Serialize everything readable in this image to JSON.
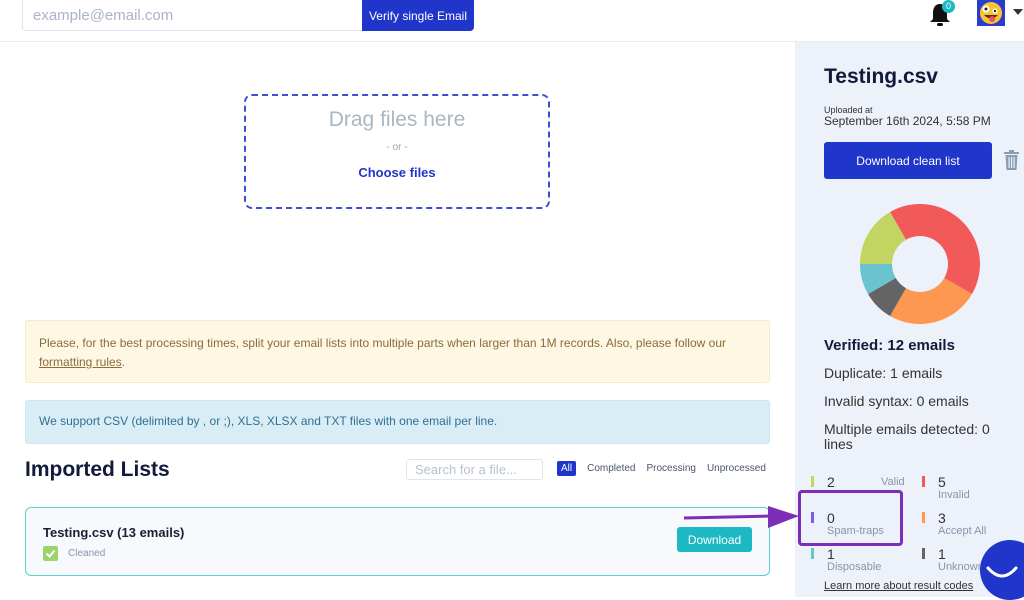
{
  "topbar": {
    "email_placeholder": "example@email.com",
    "verify_button": "Verify single Email",
    "notification_count": "0"
  },
  "upload": {
    "title": "Drag files here",
    "or": "- or -",
    "choose": "Choose files"
  },
  "notices": {
    "warning_text": "Please, for the best processing times, split your email lists into multiple parts when larger than 1M records. Also, please follow our ",
    "warning_link": "formatting rules",
    "warning_end": ".",
    "info_text": "We support CSV (delimited by , or ;), XLS, XLSX and TXT files with one email per line."
  },
  "imported": {
    "title": "Imported Lists",
    "search_placeholder": "Search for a file...",
    "filters": [
      "All",
      "Completed",
      "Processing",
      "Unprocessed"
    ],
    "active_filter": "All",
    "lists": [
      {
        "name": "Testing.csv (13 emails)",
        "status": "Cleaned",
        "action": "Download"
      }
    ]
  },
  "sidebar": {
    "file_title": "Testing.csv",
    "uploaded_label": "Uploaded at",
    "uploaded_date": "September 16th 2024, 5:58 PM",
    "download_clean": "Download clean list",
    "verified": "Verified: 12 emails",
    "duplicate": "Duplicate: 1 emails",
    "invalid_syntax": "Invalid syntax: 0 emails",
    "multiple": "Multiple emails detected: 0 lines",
    "learn_more": "Learn more about result codes",
    "results": [
      {
        "key": "valid",
        "count": "2",
        "label": "Valid",
        "color": "#c2d563"
      },
      {
        "key": "invalid",
        "count": "5",
        "label": "Invalid",
        "color": "#f25a5a"
      },
      {
        "key": "spam_traps",
        "count": "0",
        "label": "Spam-traps",
        "color": "#7b5cf0"
      },
      {
        "key": "accept_all",
        "count": "3",
        "label": "Accept All",
        "color": "#fe9750"
      },
      {
        "key": "disposable",
        "count": "1",
        "label": "Disposable",
        "color": "#6ac4d0"
      },
      {
        "key": "unknown",
        "count": "1",
        "label": "Unknown",
        "color": "#646464"
      }
    ]
  },
  "chart_data": {
    "type": "pie",
    "title": "",
    "donut": true,
    "categories": [
      "Invalid",
      "Accept All",
      "Unknown",
      "Disposable",
      "Valid",
      "Spam-traps"
    ],
    "values": [
      5,
      3,
      1,
      1,
      2,
      0
    ],
    "colors": [
      "#f25a5a",
      "#fe9750",
      "#646464",
      "#6ac4d0",
      "#c2d563",
      "#7b5cf0"
    ]
  }
}
